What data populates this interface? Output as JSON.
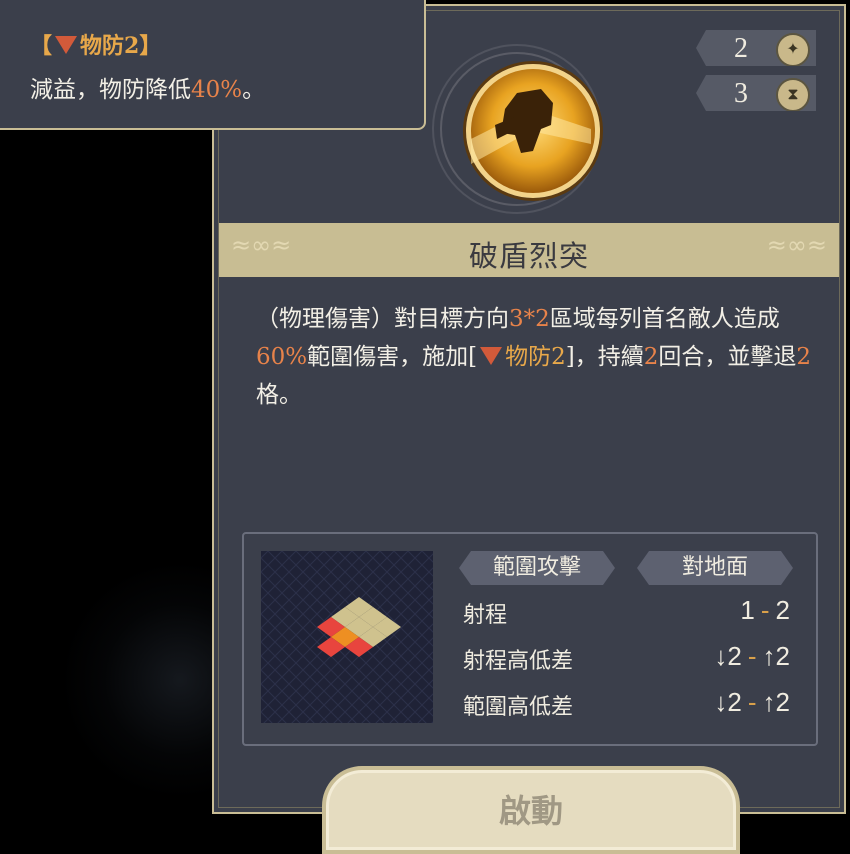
{
  "tooltip": {
    "bracket_open": "【",
    "title": "物防2",
    "bracket_close": "】",
    "desc_prefix": "減益，物防降低",
    "desc_value": "40%",
    "desc_suffix": "。"
  },
  "stats": {
    "cost": "2",
    "cooldown": "3",
    "cost_icon": "star-icon",
    "cooldown_icon": "hourglass-icon"
  },
  "skill": {
    "icon": "shield-break-icon",
    "name": "破盾烈突",
    "desc": {
      "p1": "（物理傷害）對目標方向",
      "area": "3*2",
      "p2": "區域每列首名敵人造成",
      "dmg": "60%",
      "p3": "範圍傷害，施加[",
      "buff": "物防2",
      "p4": "]，持續",
      "turns": "2",
      "p5": "回合，並擊退",
      "knock": "2",
      "p6": "格。"
    }
  },
  "info": {
    "tag_area": "範圍攻擊",
    "tag_target": "對地面",
    "range_label": "射程",
    "range_min": "1",
    "range_sep": "-",
    "range_max": "2",
    "range_height_label": "射程高低差",
    "range_height_down": "2",
    "range_height_up": "2",
    "area_height_label": "範圍高低差",
    "area_height_down": "2",
    "area_height_up": "2"
  },
  "activate_label": "啟動",
  "colors": {
    "panel": "#3b3f4b",
    "gold": "#c8bd93",
    "highlight": "#e8834a",
    "debuff": "#d25a3a"
  }
}
